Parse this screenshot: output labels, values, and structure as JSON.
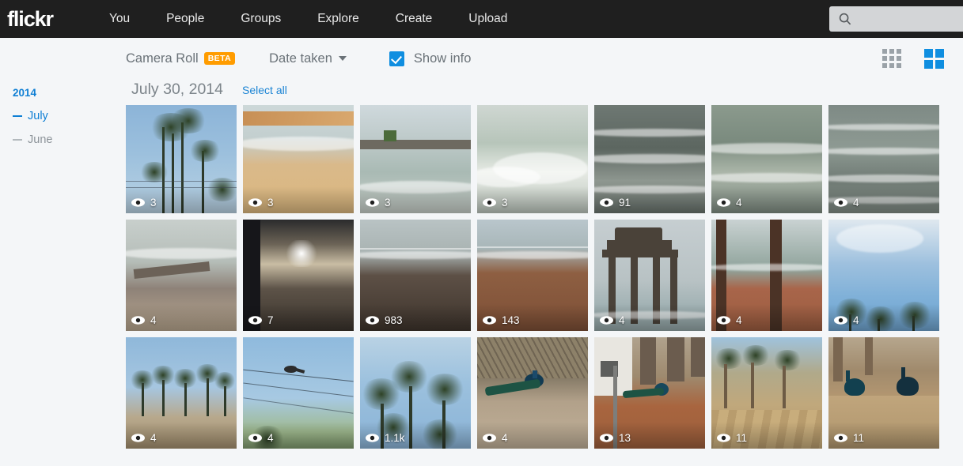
{
  "header": {
    "logo": "flickr",
    "nav": [
      {
        "label": "You"
      },
      {
        "label": "People"
      },
      {
        "label": "Groups"
      },
      {
        "label": "Explore"
      },
      {
        "label": "Create"
      },
      {
        "label": "Upload"
      }
    ],
    "search": {
      "placeholder": "",
      "value": "",
      "icon": "search-icon"
    },
    "background_color": "#1f1f1f"
  },
  "toolbar": {
    "title": "Camera Roll",
    "beta_badge": "BETA",
    "beta_color": "#ff9c00",
    "sort_label": "Date taken",
    "show_info_label": "Show info",
    "show_info_checked": true,
    "accent_color": "#0f8ee0",
    "view_small_icon": "grid-3x3-icon",
    "view_large_icon": "grid-2x2-icon",
    "view_active": "grid-2x2-icon"
  },
  "sidebar": {
    "year": "2014",
    "months": [
      {
        "label": "July",
        "active": true
      },
      {
        "label": "June",
        "active": false
      }
    ]
  },
  "main": {
    "date_heading": "July 30, 2014",
    "select_all_label": "Select all",
    "link_color": "#1b84d4",
    "rows": [
      {
        "photos": [
          {
            "alt": "palm trees against blue sky",
            "views": "3",
            "art": "sky-palms"
          },
          {
            "alt": "beach shoreline with sand",
            "views": "3",
            "art": "beach-wave"
          },
          {
            "alt": "rocky jetty in the sea",
            "views": "3",
            "art": "jetty"
          },
          {
            "alt": "breaking wave on shore",
            "views": "3",
            "art": "surf"
          },
          {
            "alt": "dark choppy sea waves",
            "views": "91",
            "art": "darksea"
          },
          {
            "alt": "green sea with white surf",
            "views": "4",
            "art": "greensea"
          },
          {
            "alt": "gray rippling ocean water",
            "views": "4",
            "art": "graysea"
          }
        ]
      },
      {
        "photos": [
          {
            "alt": "driftwood log on beach",
            "views": "4",
            "art": "driftwood"
          },
          {
            "alt": "sun setting over the sea",
            "views": "7",
            "art": "sunset"
          },
          {
            "alt": "dark sandy beach at dusk",
            "views": "983",
            "art": "darkbeach"
          },
          {
            "alt": "red sand beach with ocean",
            "views": "143",
            "art": "redsand"
          },
          {
            "alt": "stone pavilion on the shore",
            "views": "4",
            "art": "pavilion"
          },
          {
            "alt": "palm trunks over red sand and sea",
            "views": "4",
            "art": "trunksea"
          },
          {
            "alt": "palm tops against cloudy sky",
            "views": "4",
            "art": "skyclouds"
          }
        ]
      },
      {
        "photos": [
          {
            "alt": "row of palm trees on sand",
            "views": "4",
            "art": "palmrow"
          },
          {
            "alt": "bird perched on power line",
            "views": "4",
            "art": "birdwire"
          },
          {
            "alt": "palm fronds against blue sky",
            "views": "1.1k",
            "art": "palmsky"
          },
          {
            "alt": "peacock near dry brush",
            "views": "4",
            "art": "peacock1"
          },
          {
            "alt": "peacock beside a utility post",
            "views": "13",
            "art": "peacock2"
          },
          {
            "alt": "palm lined pathway",
            "views": "11",
            "art": "pathway"
          },
          {
            "alt": "two peacocks on a path",
            "views": "11",
            "art": "peabirds"
          }
        ]
      }
    ],
    "view_icon": "eye-icon"
  }
}
